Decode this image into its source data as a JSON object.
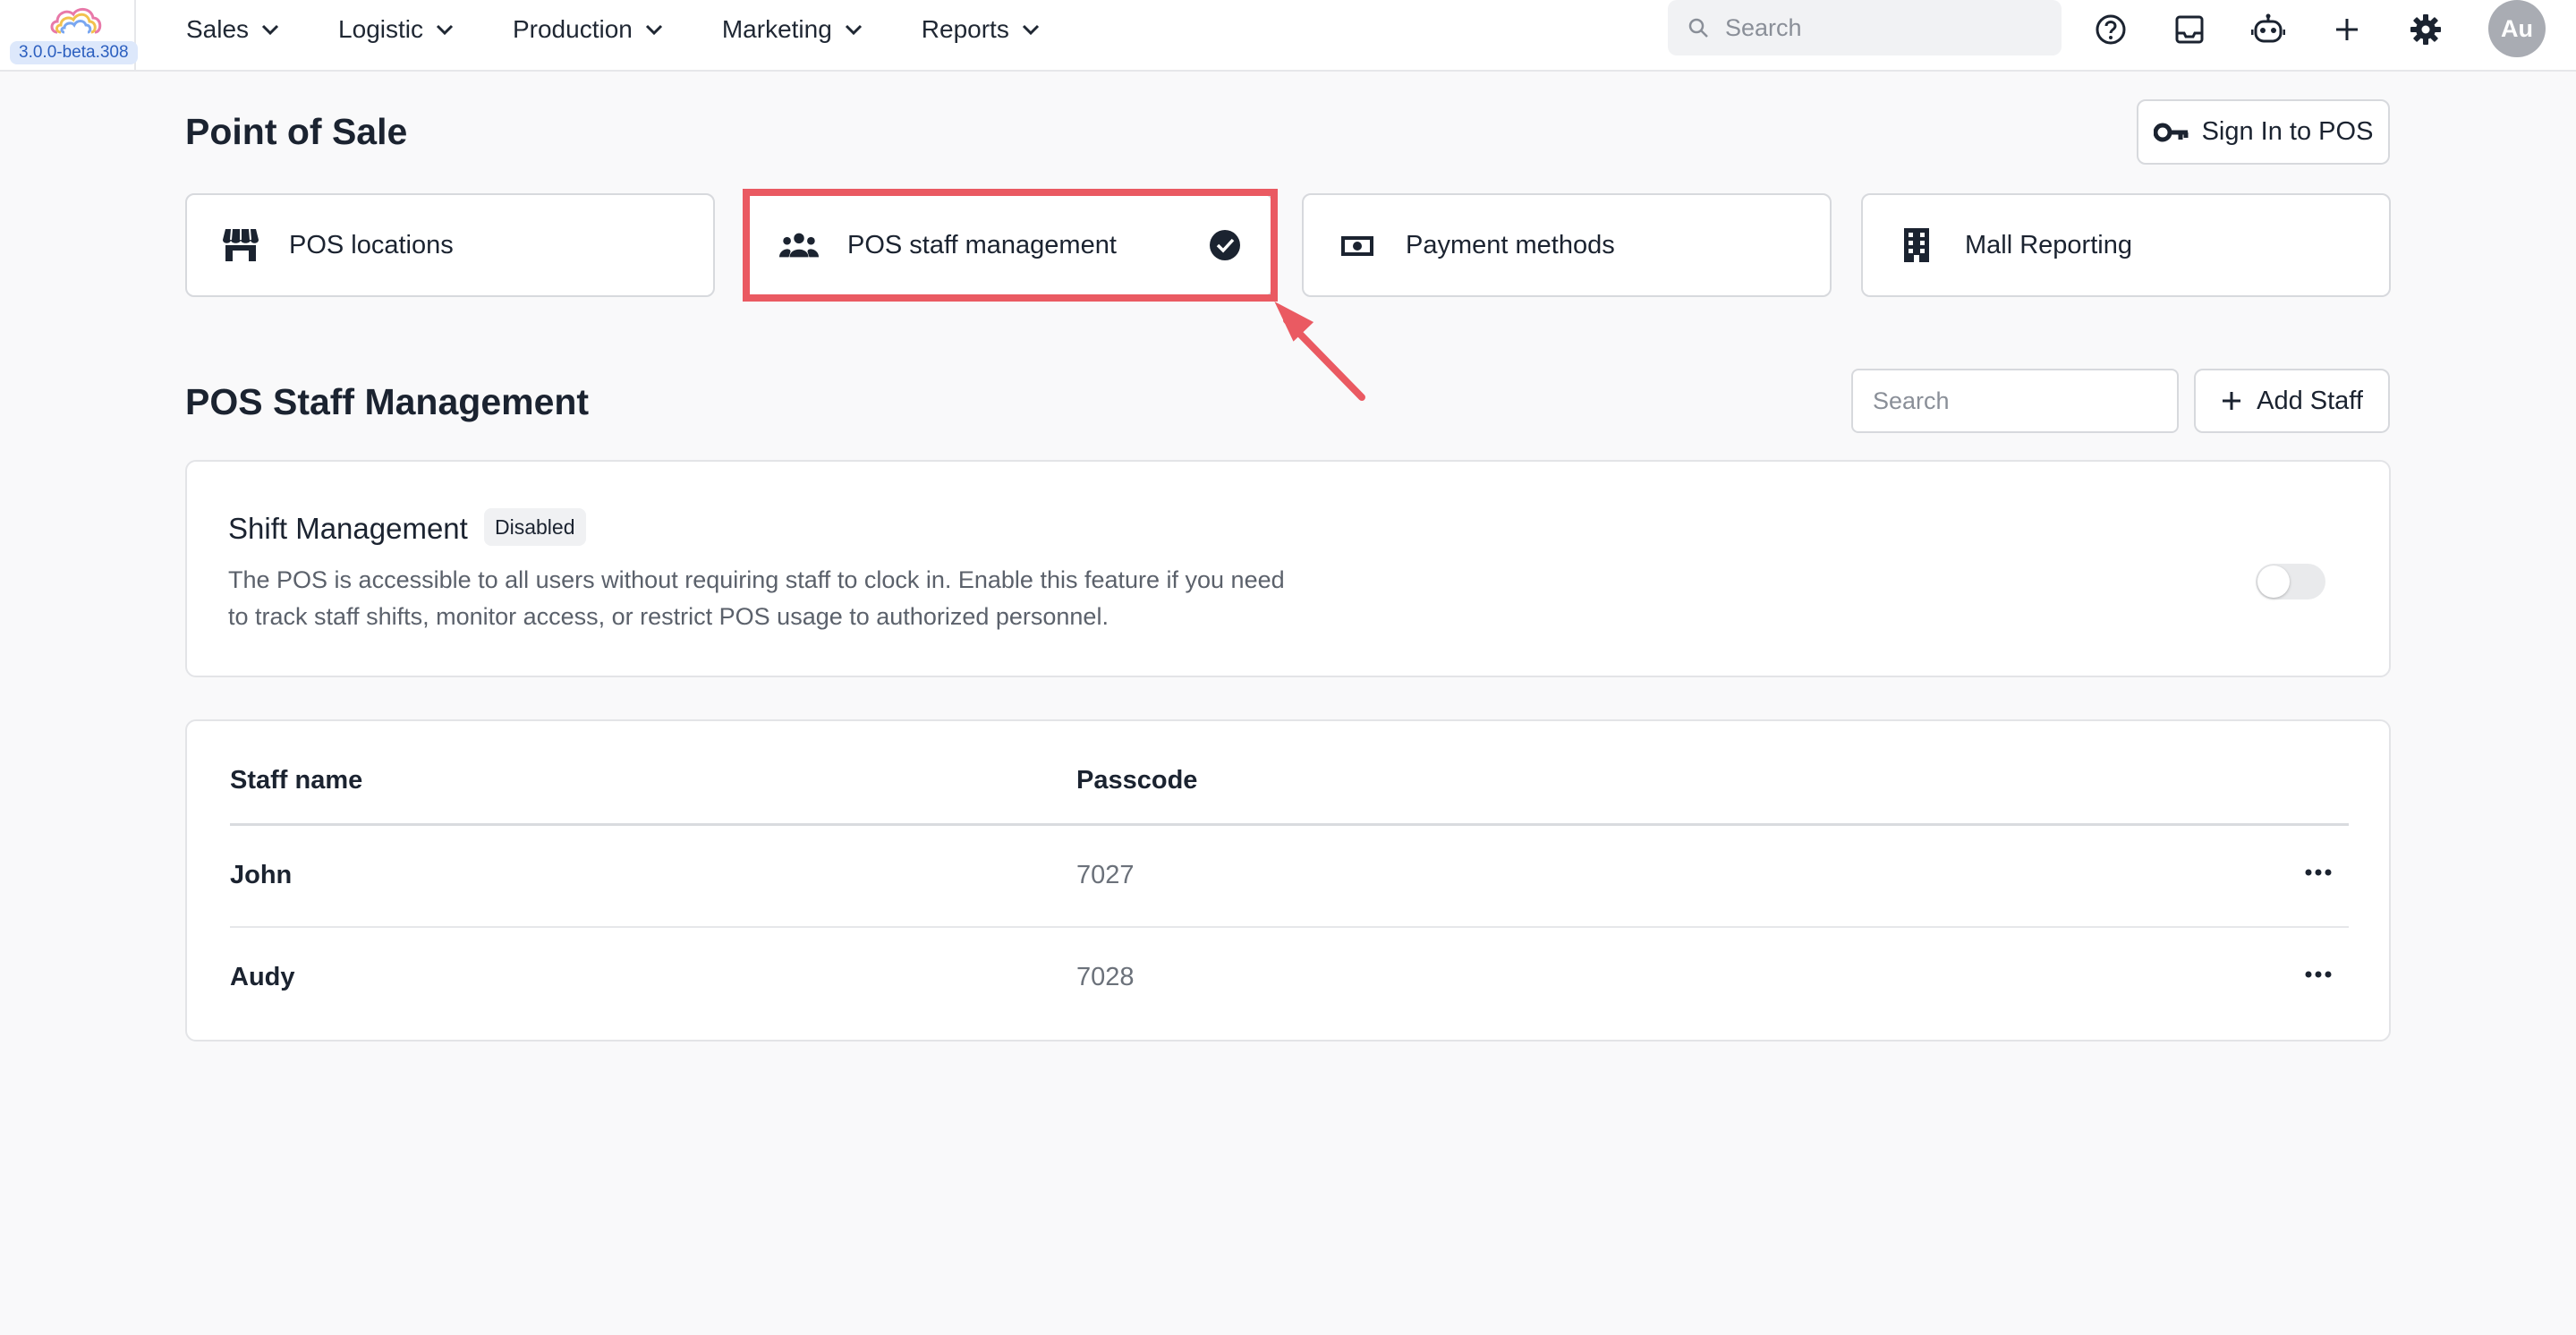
{
  "app": {
    "version": "3.0.0-beta.308",
    "colors": {
      "accent": "#ea5a62",
      "badge_bg": "#dde8fb"
    }
  },
  "nav": {
    "items": [
      {
        "label": "Sales"
      },
      {
        "label": "Logistic"
      },
      {
        "label": "Production"
      },
      {
        "label": "Marketing"
      },
      {
        "label": "Reports"
      }
    ]
  },
  "topbar": {
    "search_placeholder": "Search",
    "icons": [
      "help-icon",
      "inbox-icon",
      "robot-icon",
      "plus-icon",
      "gear-icon"
    ],
    "avatar_initials": "Au"
  },
  "page": {
    "title": "Point of Sale",
    "signin_label": "Sign In to POS"
  },
  "tabs": [
    {
      "label": "POS locations",
      "icon": "store-icon",
      "selected": false
    },
    {
      "label": "POS staff management",
      "icon": "people-icon",
      "selected": true
    },
    {
      "label": "Payment methods",
      "icon": "money-icon",
      "selected": false
    },
    {
      "label": "Mall Reporting",
      "icon": "building-icon",
      "selected": false
    }
  ],
  "staff_section": {
    "title": "POS Staff Management",
    "search_placeholder": "Search",
    "add_label": "Add Staff"
  },
  "shift": {
    "title": "Shift Management",
    "status": "Disabled",
    "description": "The POS is accessible to all users without requiring staff to clock in. Enable this feature if you need to track staff shifts, monitor access, or restrict POS usage to authorized personnel.",
    "enabled": false
  },
  "table": {
    "columns": [
      "Staff name",
      "Passcode"
    ],
    "rows": [
      {
        "name": "John",
        "passcode": "7027"
      },
      {
        "name": "Audy",
        "passcode": "7028"
      }
    ]
  }
}
